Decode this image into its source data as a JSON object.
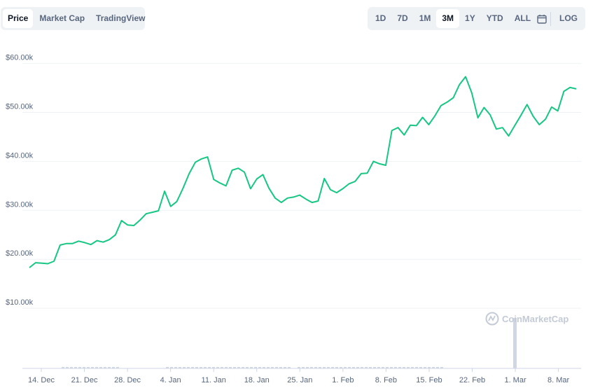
{
  "controls": {
    "left_tabs": [
      "Price",
      "Market Cap",
      "TradingView"
    ],
    "active_left": "Price",
    "range_tabs": [
      "1D",
      "7D",
      "1M",
      "3M",
      "1Y",
      "YTD",
      "ALL"
    ],
    "active_range": "3M",
    "log_label": "LOG",
    "calendar_icon": "calendar-icon"
  },
  "watermark": "CoinMarketCap",
  "colors": {
    "line": "#16c784",
    "grid": "#eff2f5",
    "volume": "#cfd6e4"
  },
  "chart_data": {
    "type": "line",
    "title": "",
    "xlabel": "",
    "ylabel": "",
    "x_ticks": [
      "14. Dec",
      "21. Dec",
      "28. Dec",
      "4. Jan",
      "11. Jan",
      "18. Jan",
      "25. Jan",
      "1. Feb",
      "8. Feb",
      "15. Feb",
      "22. Feb",
      "1. Mar",
      "8. Mar"
    ],
    "y_ticks": [
      "$10.00k",
      "$20.00k",
      "$30.00k",
      "$40.00k",
      "$50.00k",
      "$60.00k"
    ],
    "ylim": [
      0,
      60000
    ],
    "grid": true,
    "legend": "none",
    "series": [
      {
        "values": [
          18300,
          19300,
          19200,
          19100,
          19600,
          22900,
          23200,
          23200,
          23700,
          23400,
          23000,
          23800,
          23500,
          24000,
          25000,
          27900,
          27000,
          26900,
          28000,
          29300,
          29600,
          29900,
          33900,
          30800,
          31800,
          34500,
          37500,
          39800,
          40500,
          40900,
          36300,
          35600,
          35000,
          38200,
          38600,
          37800,
          34400,
          36400,
          37300,
          34500,
          32500,
          31600,
          32500,
          32700,
          33100,
          32300,
          31600,
          31900,
          36500,
          34200,
          33600,
          34400,
          35400,
          35900,
          37500,
          37600,
          40000,
          39500,
          39200,
          46300,
          46900,
          45400,
          47400,
          47300,
          49000,
          47500,
          49300,
          51400,
          52100,
          53000,
          55700,
          57300,
          54000,
          48900,
          51000,
          49500,
          46600,
          46900,
          45200,
          47300,
          49400,
          51600,
          49200,
          47500,
          48600,
          51100,
          50300,
          54300,
          55100,
          54800
        ]
      }
    ],
    "volume_spike": {
      "date": "28. Feb",
      "relative_height": 1.0
    }
  }
}
